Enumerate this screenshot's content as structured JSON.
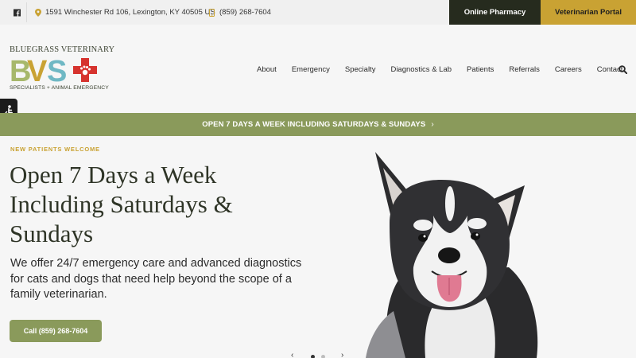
{
  "topbar": {
    "facebook_icon": "facebook-icon",
    "address": "1591 Winchester Rd 106, Lexington, KY 40505 US",
    "phone": "(859) 268-7604",
    "pharmacy_label": "Online Pharmacy",
    "vet_portal_label": "Veterinarian Portal"
  },
  "logo": {
    "top_text": "BLUEGRASS VETERINARY",
    "bottom_text": "SPECIALISTS + ANIMAL EMERGENCY",
    "mark_letters": "BVS"
  },
  "nav": {
    "items": [
      "About",
      "Emergency",
      "Specialty",
      "Diagnostics & Lab",
      "Patients",
      "Referrals",
      "Careers",
      "Contact"
    ]
  },
  "announcement": {
    "text": "OPEN 7 DAYS A WEEK INCLUDING SATURDAYS & SUNDAYS",
    "chevron": "›"
  },
  "hero": {
    "kicker": "NEW PATIENTS WELCOME",
    "title": "Open 7 Days a Week Including Saturdays & Sundays",
    "subtitle": "We offer 24/7 emergency care and advanced diagnostics for cats and dogs that need help beyond the scope of a family veterinarian.",
    "cta_label": "Call (859) 268-7604",
    "slider_prev": "‹",
    "slider_next": "›"
  },
  "colors": {
    "olive": "#8a9a5b",
    "gold": "#c9a233",
    "dark": "#262b1e",
    "red": "#d6332e",
    "teal": "#6fb8c4"
  }
}
